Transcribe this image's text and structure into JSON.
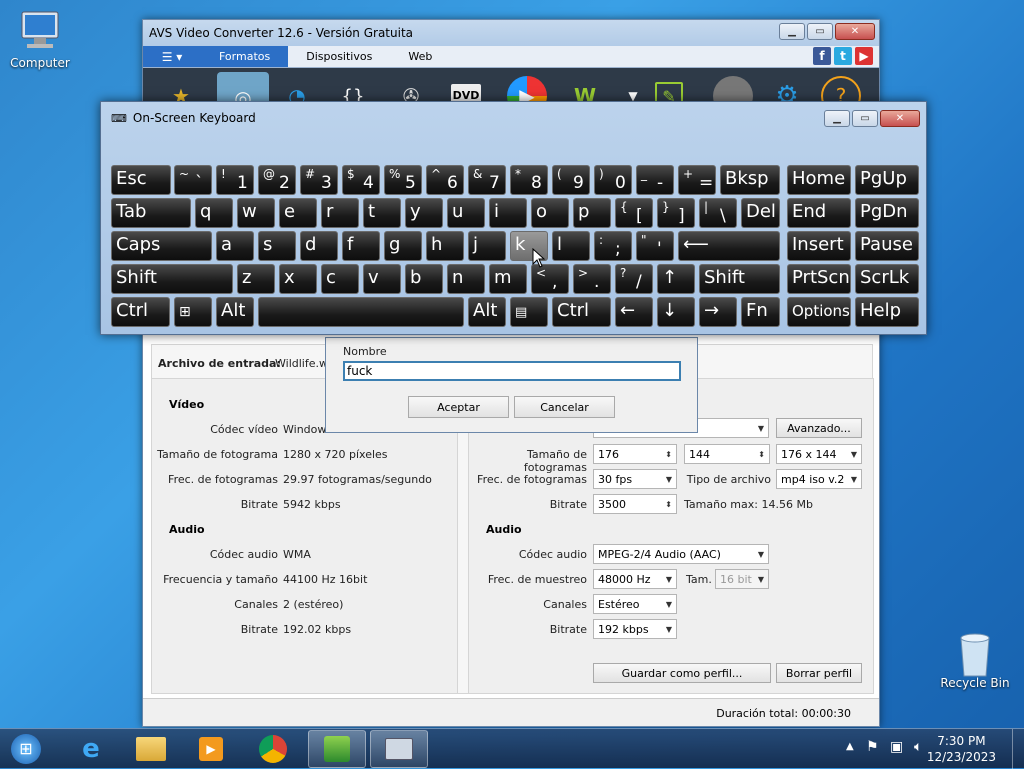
{
  "desktop": {
    "icons": [
      {
        "label": "Computer"
      },
      {
        "label": "Recycle Bin"
      }
    ]
  },
  "avs": {
    "title": "AVS Video Converter 12.6 - Versión Gratuita",
    "tabs": [
      "Formatos",
      "Dispositivos",
      "Web"
    ],
    "input_file_label": "Archivo de entrada:",
    "input_file_value": "Wildlife.wn",
    "left": {
      "video_header": "Vídeo",
      "rows_video": [
        {
          "label": "Códec vídeo",
          "value": "Windows"
        },
        {
          "label": "Tamaño de fotograma",
          "value": "1280 x 720 píxeles"
        },
        {
          "label": "Frec. de fotogramas",
          "value": "29.97 fotogramas/segundo"
        },
        {
          "label": "Bitrate",
          "value": "5942 kbps"
        }
      ],
      "audio_header": "Audio",
      "rows_audio": [
        {
          "label": "Códec audio",
          "value": "WMA"
        },
        {
          "label": "Frecuencia y tamaño",
          "value": "44100 Hz 16bit"
        },
        {
          "label": "Canales",
          "value": "2 (estéreo)"
        },
        {
          "label": "Bitrate",
          "value": "192.02 kbps"
        }
      ]
    },
    "right": {
      "advanced_button": "Avanzado...",
      "frame_size_label": "Tamaño de fotogramas",
      "frame_w": "176",
      "frame_h": "144",
      "frame_combo": "176 x 144",
      "fps_label": "Frec. de fotogramas",
      "fps_value": "30 fps",
      "file_type_label": "Tipo de archivo",
      "file_type_value": "mp4 iso v.2",
      "bitrate_label": "Bitrate",
      "bitrate_value": "3500",
      "max_size_label": "Tamaño max: 14.56 Mb",
      "audio_header": "Audio",
      "audio_codec_label": "Códec audio",
      "audio_codec_value": "MPEG-2/4 Audio (AAC)",
      "sample_label": "Frec. de muestreo",
      "sample_value": "48000 Hz",
      "tam_label": "Tam.",
      "tam_value": "16 bit",
      "channels_label": "Canales",
      "channels_value": "Estéreo",
      "abitrate_label": "Bitrate",
      "abitrate_value": "192 kbps",
      "save_profile": "Guardar como perfil...",
      "delete_profile": "Borrar perfil"
    },
    "status_duration": "Duración total: 00:00:30"
  },
  "dialog": {
    "label": "Nombre",
    "value": "fuck",
    "ok": "Aceptar",
    "cancel": "Cancelar"
  },
  "osk": {
    "title": "On-Screen Keyboard"
  },
  "taskbar": {
    "time": "7:30 PM",
    "date": "12/23/2023"
  }
}
